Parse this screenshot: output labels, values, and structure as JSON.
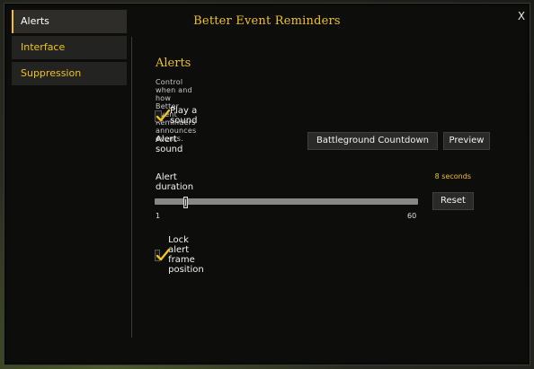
{
  "window": {
    "title": "Better Event Reminders",
    "close_label": "X"
  },
  "sidebar": {
    "items": [
      {
        "label": "Alerts",
        "active": true
      },
      {
        "label": "Interface",
        "active": false
      },
      {
        "label": "Suppression",
        "active": false
      }
    ]
  },
  "main": {
    "section_title": "Alerts",
    "description": "Control when and how Better Event Reminders announces events.",
    "play_sound": {
      "label": "Play a sound",
      "checked": true
    },
    "alert_sound": {
      "label": "Alert sound",
      "selected": "Battleground Countdown",
      "preview_label": "Preview"
    },
    "alert_duration": {
      "label": "Alert duration",
      "value_text": "8 seconds",
      "min_label": "1",
      "max_label": "60",
      "min": 1,
      "max": 60,
      "value": 8,
      "reset_label": "Reset"
    },
    "lock_frame": {
      "label": "Lock alert frame position",
      "checked": true
    }
  },
  "colors": {
    "accent": "#f0c21f",
    "panel": "#0d0d0c",
    "text": "#f2f2f2"
  }
}
